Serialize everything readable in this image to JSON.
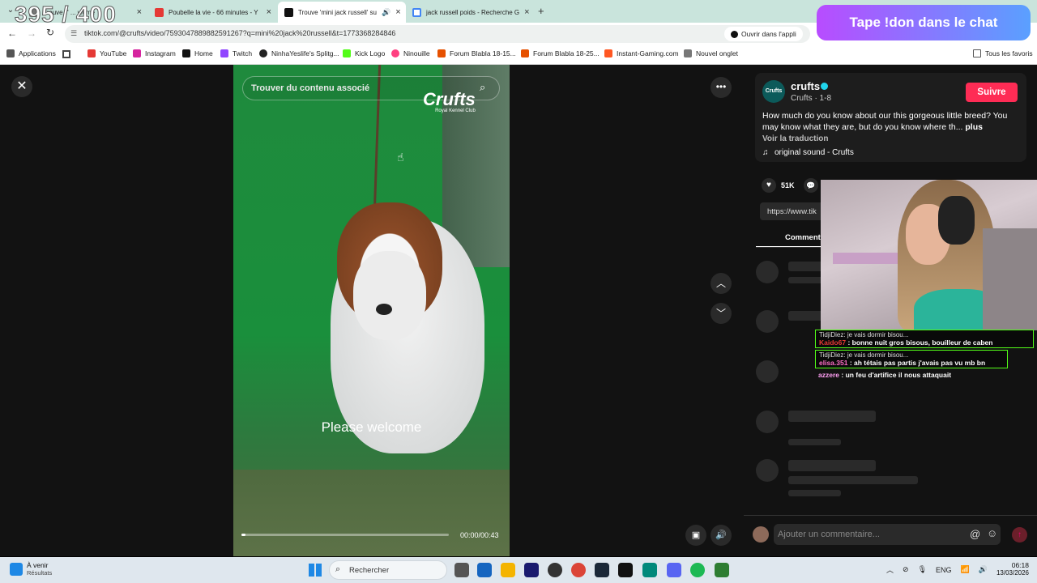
{
  "overlay": {
    "counter": "395 / 400",
    "donation_banner": "Tape !don dans le chat"
  },
  "browser": {
    "tabs": [
      {
        "label": "Trouve 'l' ... wome",
        "color": "#777"
      },
      {
        "label": "Poubelle la vie - 66 minutes - Y",
        "color": "#e53935"
      },
      {
        "label": "Trouve 'mini jack russell' su",
        "color": "#111"
      },
      {
        "label": "jack russell poids - Recherche G",
        "color": "#4285f4"
      }
    ],
    "new_tab_label": "+",
    "url": "tiktok.com/@crufts/video/7593047889882591267?q=mini%20jack%20russell&t=1773368284846",
    "open_app_label": "Ouvrir dans l'appli",
    "bookmarks": [
      {
        "label": "Applications",
        "color": "#555"
      },
      {
        "label": "YouTube",
        "color": "#e53935"
      },
      {
        "label": "Instagram",
        "color": "#d6249f"
      },
      {
        "label": "Home",
        "color": "#111"
      },
      {
        "label": "Twitch",
        "color": "#9146ff"
      },
      {
        "label": "NinhaYeslife's Splitg...",
        "color": "#222"
      },
      {
        "label": "Kick Logo",
        "color": "#53fc18"
      },
      {
        "label": "Ninouille",
        "color": "#ff4081"
      },
      {
        "label": "Forum Blabla 18-15...",
        "color": "#e65100"
      },
      {
        "label": "Forum Blabla 18-25...",
        "color": "#e65100"
      },
      {
        "label": "Instant-Gaming.com",
        "color": "#ff5722"
      },
      {
        "label": "Nouvel onglet",
        "color": "#777"
      }
    ],
    "all_bookmarks_label": "Tous les favoris"
  },
  "video": {
    "search_placeholder": "Trouver du contenu associé",
    "brand": "Crufts",
    "brand_sub": "Royal Kennel Club",
    "caption": "Please welcome",
    "time": "00:00/00:43",
    "progress": 0.02
  },
  "sidebar": {
    "username": "crufts",
    "subline": "Crufts · 1-8",
    "follow_label": "Suivre",
    "description": "How much do you know about our this gorgeous little breed? You may know what they are, but do you know where th...",
    "more_label": "plus",
    "translate_label": "Voir la traduction",
    "sound": "original sound - Crufts",
    "likes": "51K",
    "link": "https://www.tik",
    "comments_tab": "Comment",
    "comment_placeholder": "Ajouter un commentaire..."
  },
  "chat": [
    {
      "reply_to": "TidjiDiez: je vais dormir bisou...",
      "user": "Kaido67",
      "user_color": "#e53935",
      "msg": "bonne nuit gros bisous, bouilleur de caben"
    },
    {
      "reply_to": "TidjiDiez: je vais dormir bisou...",
      "user": "elisa.351",
      "user_color": "#ff6ec7",
      "msg": "ah tétais pas partis j'avais pas vu mb bn"
    },
    {
      "reply_to": "",
      "user": "azzere",
      "user_color": "#ff9ff3",
      "msg": "un feu d'artifice il nous attaquait"
    }
  ],
  "taskbar": {
    "weather_title": "À venir",
    "weather_sub": "Résultats",
    "search_label": "Rechercher",
    "lang": "ENG",
    "time": "06:18",
    "date": "13/03/2026"
  }
}
